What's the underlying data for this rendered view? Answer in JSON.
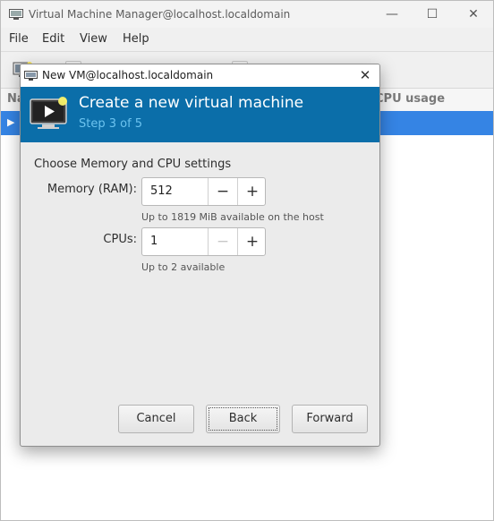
{
  "main_window": {
    "title": "Virtual Machine Manager@localhost.localdomain",
    "controls": {
      "minimize": "—",
      "maximize": "☐",
      "close": "✕"
    },
    "menu": [
      "File",
      "Edit",
      "View",
      "Help"
    ],
    "list_header": {
      "name_col": "Na",
      "cpu_col": "CPU usage"
    },
    "selected_row_expander": "▶"
  },
  "dialog": {
    "title": "New VM@localhost.localdomain",
    "close": "✕",
    "banner": {
      "title": "Create a new virtual machine",
      "step": "Step 3 of 5",
      "icon": "monitor-play-icon"
    },
    "section_label": "Choose Memory and CPU settings",
    "memory": {
      "label": "Memory (RAM):",
      "value": "512",
      "minus": "−",
      "plus": "+",
      "hint": "Up to 1819 MiB available on the host"
    },
    "cpus": {
      "label": "CPUs:",
      "value": "1",
      "minus": "−",
      "plus": "+",
      "hint": "Up to 2 available"
    },
    "buttons": {
      "cancel": "Cancel",
      "back": "Back",
      "forward": "Forward"
    }
  },
  "colors": {
    "banner_bg": "#0b6ea9",
    "banner_step": "#6cc3ef",
    "selection": "#3584e4"
  }
}
